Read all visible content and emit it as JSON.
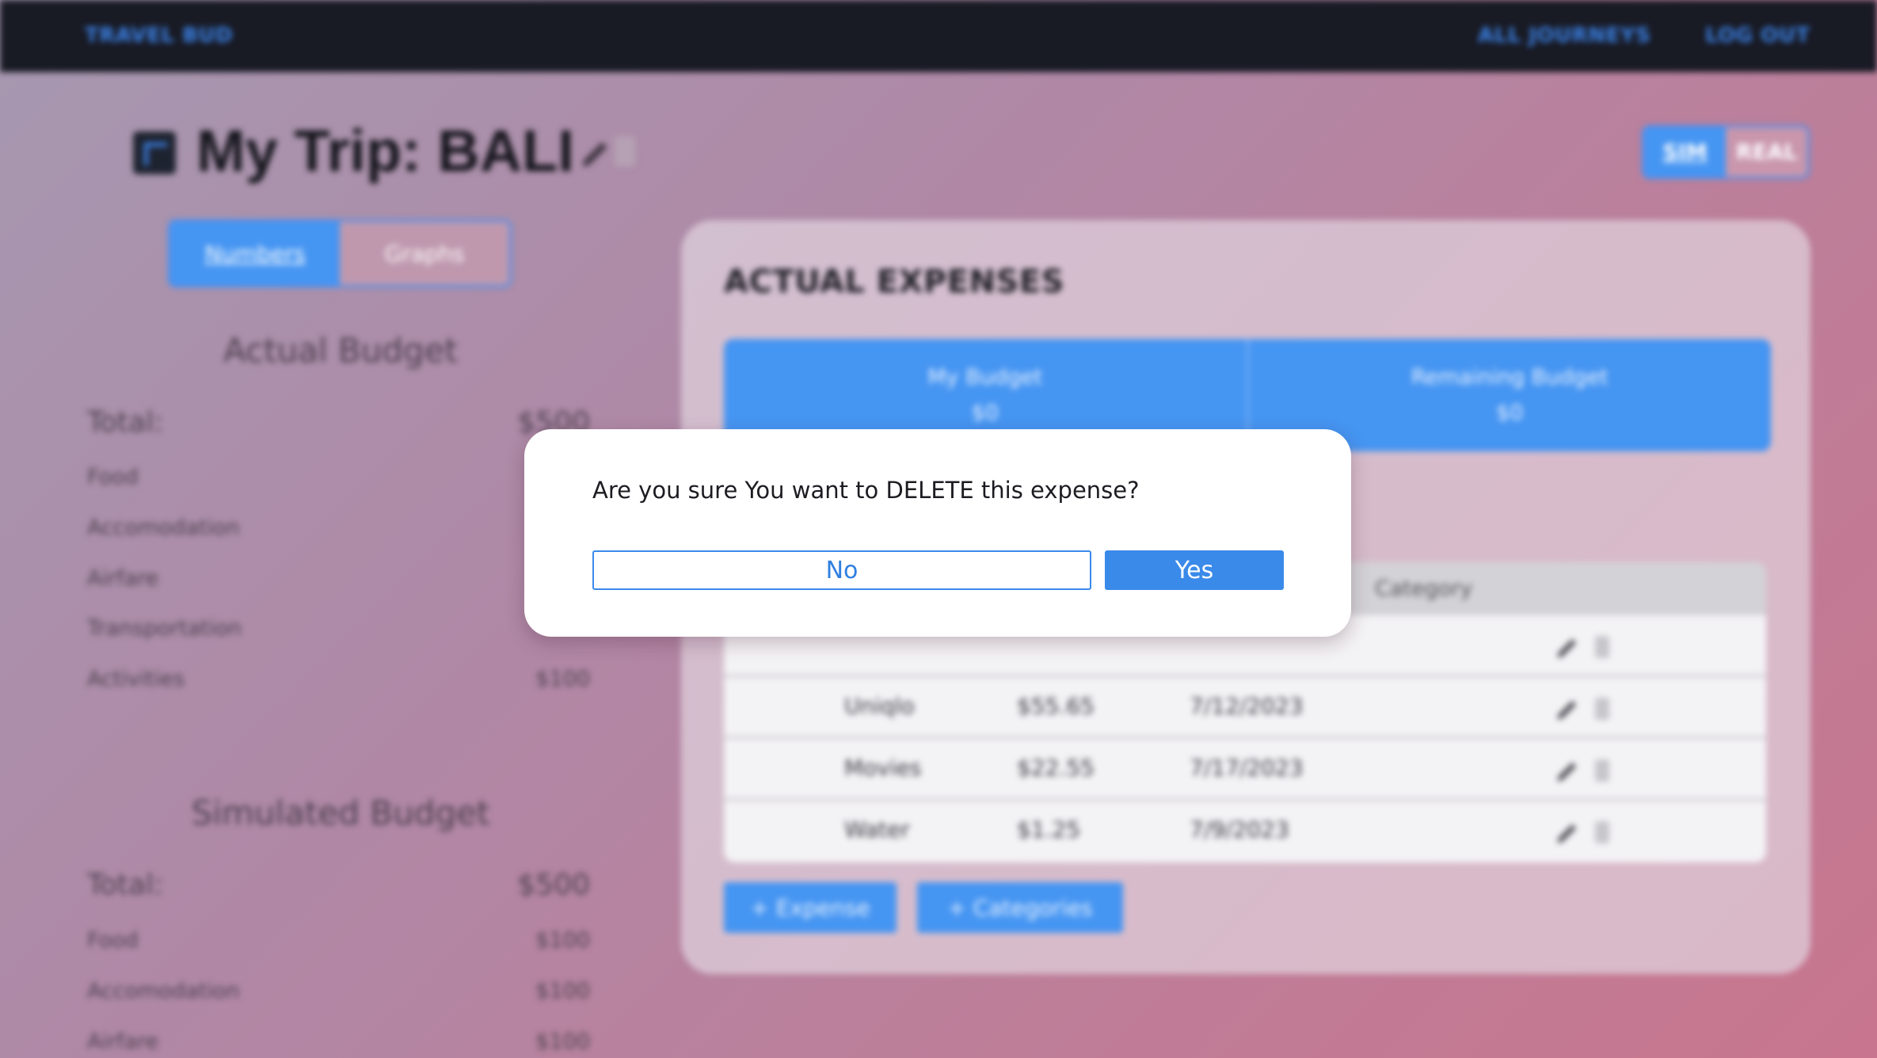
{
  "navbar": {
    "brand": "TRAVEL BUD",
    "all_journeys": "ALL JOURNEYS",
    "log_out": "LOG OUT"
  },
  "header": {
    "trip_title": "My Trip: BALI",
    "mode_toggle": {
      "sim": "SIM",
      "real": "REAL",
      "active": "SIM"
    }
  },
  "view_tabs": {
    "numbers": "Numbers",
    "graphs": "Graphs",
    "active": "Numbers"
  },
  "actual_budget": {
    "heading": "Actual Budget",
    "total_label": "Total:",
    "total_value": "$500",
    "items": [
      {
        "label": "Food",
        "value": ""
      },
      {
        "label": "Accomodation",
        "value": ""
      },
      {
        "label": "Airfare",
        "value": ""
      },
      {
        "label": "Transportation",
        "value": ""
      },
      {
        "label": "Activities",
        "value": "$100"
      }
    ]
  },
  "simulated_budget": {
    "heading": "Simulated Budget",
    "total_label": "Total:",
    "total_value": "$500",
    "items": [
      {
        "label": "Food",
        "value": "$100"
      },
      {
        "label": "Accomodation",
        "value": "$100"
      },
      {
        "label": "Airfare",
        "value": "$100"
      }
    ]
  },
  "expenses_card": {
    "title": "ACTUAL EXPENSES",
    "my_budget_label": "My Budget",
    "my_budget_value": "$0",
    "remaining_label": "Remaining Budget",
    "remaining_value": "$0",
    "table": {
      "category_header": "Category",
      "rows": [
        {
          "name": "Uniqlo",
          "amount": "$55.65",
          "date": "7/12/2023"
        },
        {
          "name": "Movies",
          "amount": "$22.55",
          "date": "7/17/2023"
        },
        {
          "name": "Water",
          "amount": "$1.25",
          "date": "7/9/2023"
        }
      ]
    },
    "add_expense": "+ Expense",
    "add_categories": "+ Categories"
  },
  "modal": {
    "message": "Are you sure You want to DELETE this expense?",
    "no_label": "No",
    "yes_label": "Yes"
  }
}
